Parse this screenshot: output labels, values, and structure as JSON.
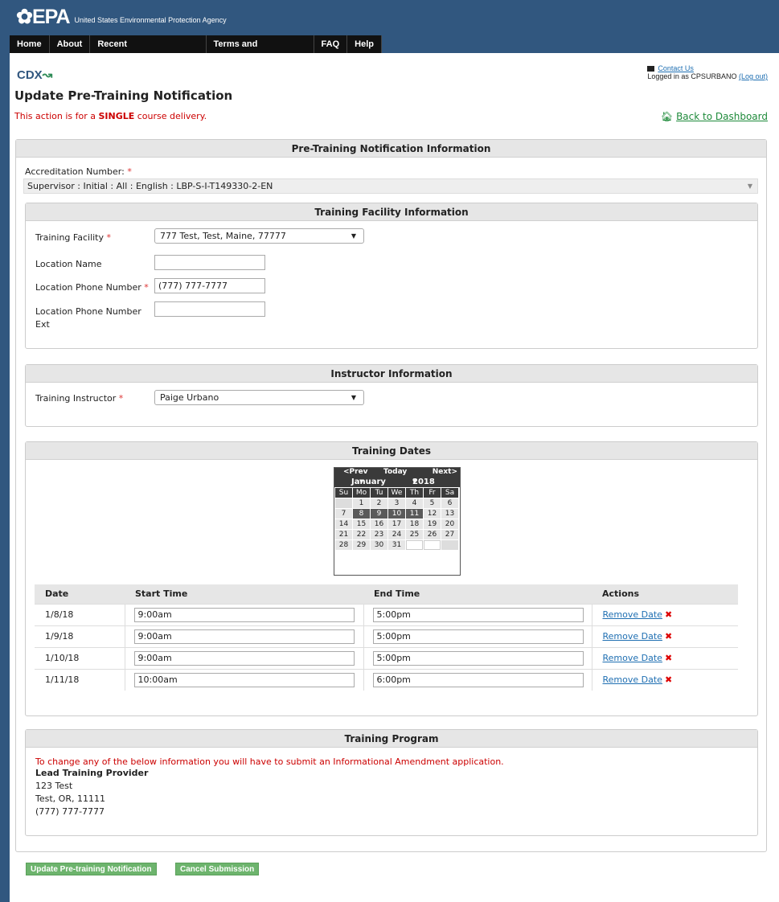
{
  "brand": {
    "logo_mark": "EPA",
    "agency": "United States Environmental Protection Agency",
    "cdx_a": "CDX",
    "cdx_b": ""
  },
  "nav": [
    "Home",
    "About",
    "Recent Announcements",
    "Terms and Conditions",
    "FAQ",
    "Help"
  ],
  "user": {
    "contact": "Contact Us",
    "logged_in": "Logged in as CPSURBANO",
    "logout": "(Log out)"
  },
  "page": {
    "title": "Update Pre-Training Notification",
    "note_prefix": "This action is for a ",
    "note_emph": "SINGLE",
    "note_suffix": " course delivery.",
    "back": "Back to Dashboard"
  },
  "main_panel": {
    "heading": "Pre-Training Notification Information",
    "accreditation_label": "Accreditation Number:",
    "accreditation_value": "Supervisor : Initial : All : English : LBP-S-I-T149330-2-EN"
  },
  "facility": {
    "heading": "Training Facility Information",
    "facility_label": "Training Facility",
    "facility_value": "777 Test, Test, Maine, 77777",
    "location_name_label": "Location Name",
    "location_name_value": "",
    "phone_label": "Location Phone Number",
    "phone_value": "(777) 777-7777",
    "ext_label_1": "Location Phone Number",
    "ext_label_2": "Ext",
    "ext_value": ""
  },
  "instructor": {
    "heading": "Instructor Information",
    "label": "Training Instructor",
    "value": "Paige Urbano"
  },
  "dates": {
    "heading": "Training Dates",
    "calendar": {
      "prev": "<Prev",
      "today": "Today",
      "next": "Next>",
      "month": "January",
      "year": "2018",
      "dow": [
        "Su",
        "Mo",
        "Tu",
        "We",
        "Th",
        "Fr",
        "Sa"
      ],
      "days": [
        "",
        "1",
        "2",
        "3",
        "4",
        "5",
        "6",
        "7",
        "8",
        "9",
        "10",
        "11",
        "12",
        "13",
        "14",
        "15",
        "16",
        "17",
        "18",
        "19",
        "20",
        "21",
        "22",
        "23",
        "24",
        "25",
        "26",
        "27",
        "28",
        "29",
        "30",
        "31",
        "",
        "",
        ""
      ],
      "selected": [
        "8",
        "9",
        "10",
        "11"
      ]
    },
    "columns": [
      "Date",
      "Start Time",
      "End Time",
      "Actions"
    ],
    "rows": [
      {
        "date": "1/8/18",
        "start": "9:00am",
        "end": "5:00pm",
        "action": "Remove Date"
      },
      {
        "date": "1/9/18",
        "start": "9:00am",
        "end": "5:00pm",
        "action": "Remove Date"
      },
      {
        "date": "1/10/18",
        "start": "9:00am",
        "end": "5:00pm",
        "action": "Remove Date"
      },
      {
        "date": "1/11/18",
        "start": "10:00am",
        "end": "6:00pm",
        "action": "Remove Date"
      }
    ]
  },
  "program": {
    "heading": "Training Program",
    "notice": "To change any of the below information you will have to submit an Informational Amendment application.",
    "name": "Lead Training Provider",
    "address1": "123 Test",
    "address2": "Test, OR, 11111",
    "phone": "(777) 777-7777"
  },
  "buttons": {
    "update": "Update Pre-training Notification",
    "cancel": "Cancel Submission"
  },
  "colors": {
    "header": "#31577f",
    "nav": "#111111",
    "link": "#1f6fb2",
    "required": "#dd3333",
    "button": "#6db46d"
  }
}
